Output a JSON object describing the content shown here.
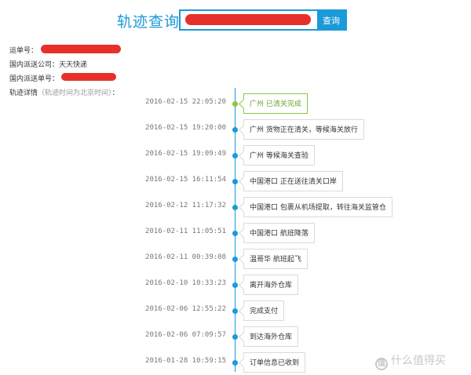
{
  "search": {
    "title": "轨迹查询",
    "input_value": "",
    "button_label": "查询"
  },
  "info": {
    "waybill_label": "运单号：",
    "carrier_label": "国内派送公司：",
    "carrier_value": "天天快递",
    "domestic_waybill_label": "国内派送单号：",
    "details_label": "轨迹详情",
    "details_note": "（轨迹时间为北京时间）",
    "details_colon": "："
  },
  "timeline": [
    {
      "time": "2016-02-15 22:05:20",
      "status": "广州 已清关完成"
    },
    {
      "time": "2016-02-15 19:20:00",
      "status": "广州 货物正在清关，等候海关放行"
    },
    {
      "time": "2016-02-15 19:09:49",
      "status": "广州 等候海关查验"
    },
    {
      "time": "2016-02-15 16:11:54",
      "status": "中国港口 正在送往清关口岸"
    },
    {
      "time": "2016-02-12 11:17:32",
      "status": "中国港口 包裹从机场提取，转往海关监管仓"
    },
    {
      "time": "2016-02-11 11:05:51",
      "status": "中国港口 航班降落"
    },
    {
      "time": "2016-02-11 00:39:08",
      "status": "温哥华 航班起飞"
    },
    {
      "time": "2016-02-10 10:33:23",
      "status": "离开海外仓库"
    },
    {
      "time": "2016-02-06 12:55:22",
      "status": "完成支付"
    },
    {
      "time": "2016-02-06 07:09:57",
      "status": "到达海外仓库"
    },
    {
      "time": "2016-01-28 10:59:15",
      "status": "订单信息已收到"
    }
  ],
  "watermark": {
    "icon_glyph": "值",
    "text": "什么值得买"
  },
  "colors": {
    "accent": "#1a9ad8",
    "latest": "#8cc63f",
    "redaction": "#e8302a"
  }
}
